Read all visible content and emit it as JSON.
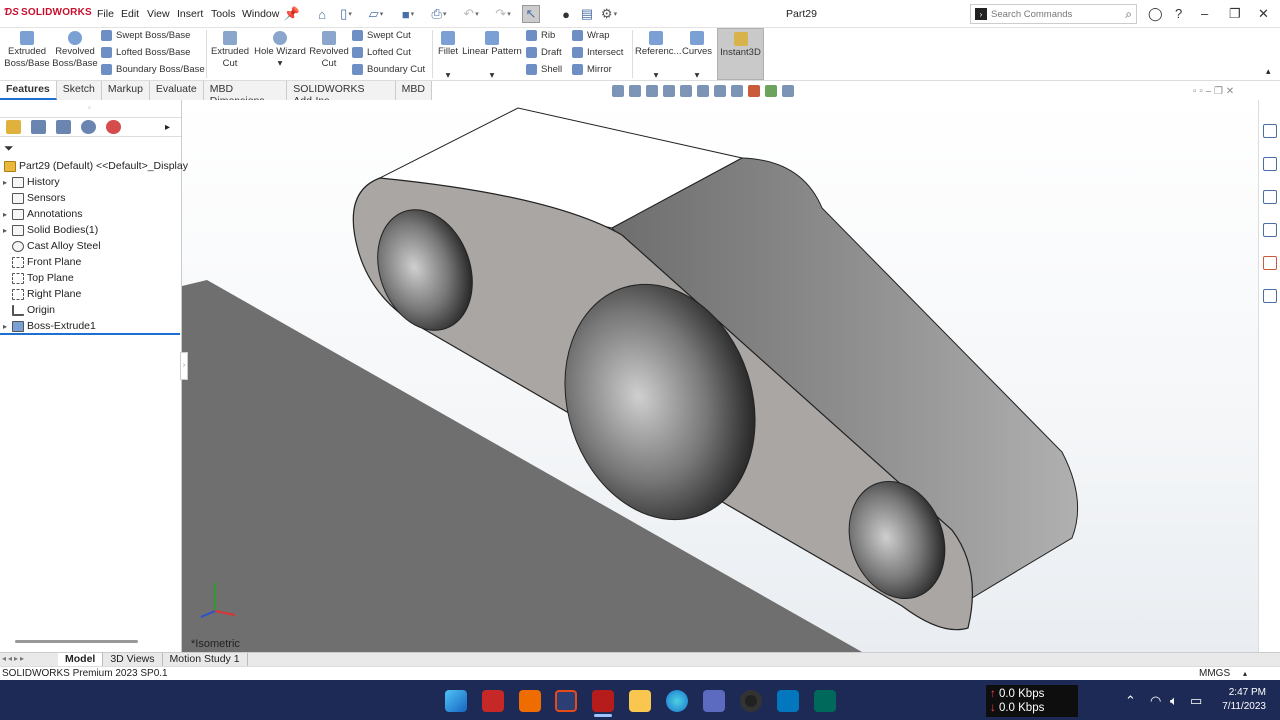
{
  "app": {
    "brand": "SOLIDWORKS",
    "doc_title": "Part29"
  },
  "menu": [
    "File",
    "Edit",
    "View",
    "Insert",
    "Tools",
    "Window"
  ],
  "search": {
    "placeholder": "Search Commands"
  },
  "ribbon": {
    "extruded_boss": "Extruded Boss/Base",
    "revolved_boss": "Revolved Boss/Base",
    "swept_boss": "Swept Boss/Base",
    "lofted_boss": "Lofted Boss/Base",
    "boundary_boss": "Boundary Boss/Base",
    "extruded_cut": "Extruded Cut",
    "hole_wizard": "Hole Wizard",
    "revolved_cut": "Revolved Cut",
    "swept_cut": "Swept Cut",
    "lofted_cut": "Lofted Cut",
    "boundary_cut": "Boundary Cut",
    "fillet": "Fillet",
    "linear_pattern": "Linear Pattern",
    "rib": "Rib",
    "draft": "Draft",
    "shell": "Shell",
    "wrap": "Wrap",
    "intersect": "Intersect",
    "mirror": "Mirror",
    "reference": "Referenc...",
    "curves": "Curves",
    "instant3d": "Instant3D"
  },
  "tabs": [
    "Features",
    "Sketch",
    "Markup",
    "Evaluate",
    "MBD Dimensions",
    "SOLIDWORKS Add-Ins",
    "MBD"
  ],
  "tree": {
    "root": "Part29 (Default) <<Default>_Display",
    "items": [
      "History",
      "Sensors",
      "Annotations",
      "Solid Bodies(1)",
      "Cast Alloy Steel",
      "Front Plane",
      "Top Plane",
      "Right Plane",
      "Origin",
      "Boss-Extrude1"
    ]
  },
  "viewport": {
    "view_label": "*Isometric"
  },
  "bottom_tabs": [
    "Model",
    "3D Views",
    "Motion Study 1"
  ],
  "status": {
    "product": "SOLIDWORKS Premium 2023 SP0.1",
    "units": "MMGS"
  },
  "taskbar": {
    "net_up": "0.0 Kbps",
    "net_down": "0.0 Kbps",
    "time": "2:47 PM",
    "date": "7/11/2023"
  },
  "colors": {
    "accent": "#1f6fd1",
    "taskbar": "#1c2a55",
    "brand": "#c8102e"
  }
}
